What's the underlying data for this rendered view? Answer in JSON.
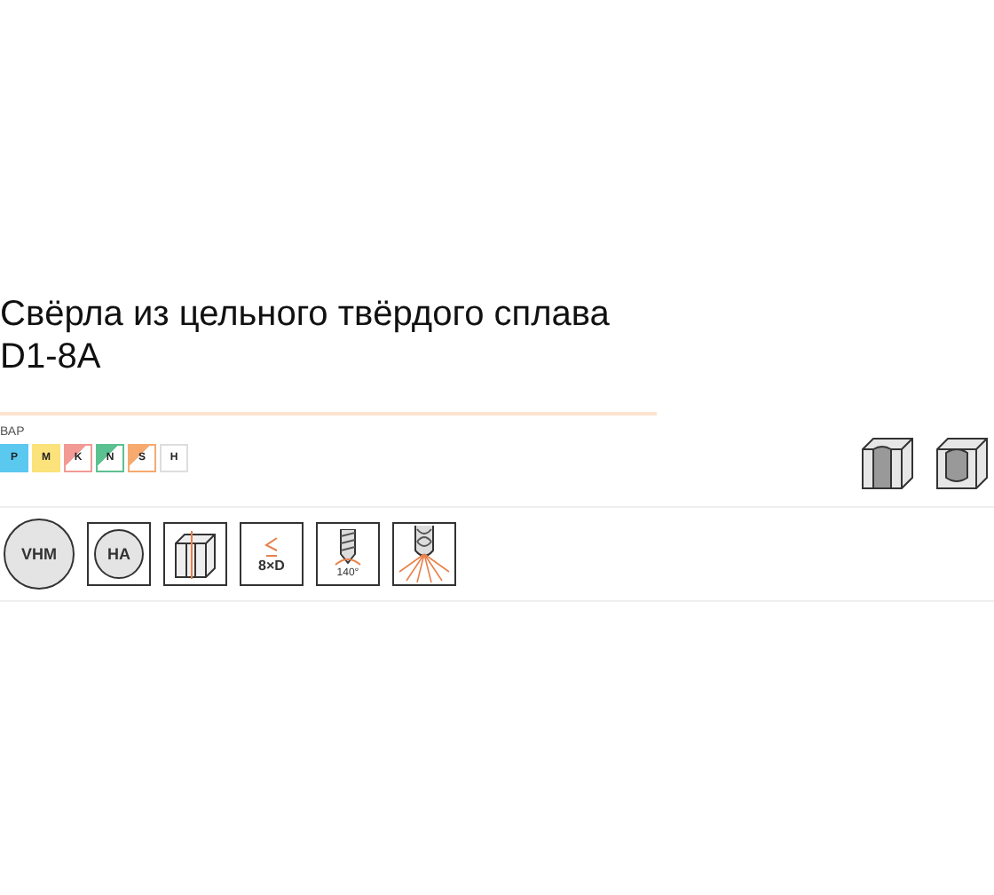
{
  "title": "Свёрла из цельного твёрдого сплава D1-8A",
  "materials": {
    "label": "ВАР",
    "groups": [
      {
        "letter": "P",
        "kind": "full",
        "color": "#5bc8f0"
      },
      {
        "letter": "M",
        "kind": "full",
        "color": "#fbe27a"
      },
      {
        "letter": "K",
        "kind": "half",
        "color": "#f29a93"
      },
      {
        "letter": "N",
        "kind": "half",
        "color": "#5cc190"
      },
      {
        "letter": "S",
        "kind": "half",
        "color": "#f7aa6f"
      },
      {
        "letter": "H",
        "kind": "none",
        "color": "#ffffff"
      }
    ]
  },
  "hole_types": [
    {
      "kind": "through"
    },
    {
      "kind": "blind"
    }
  ],
  "features": [
    {
      "kind": "grade",
      "text": "VHM"
    },
    {
      "kind": "coating",
      "text": "HA"
    },
    {
      "kind": "shank"
    },
    {
      "kind": "depth",
      "text": "8×D"
    },
    {
      "kind": "angle",
      "text": "140°"
    },
    {
      "kind": "coolant"
    }
  ]
}
